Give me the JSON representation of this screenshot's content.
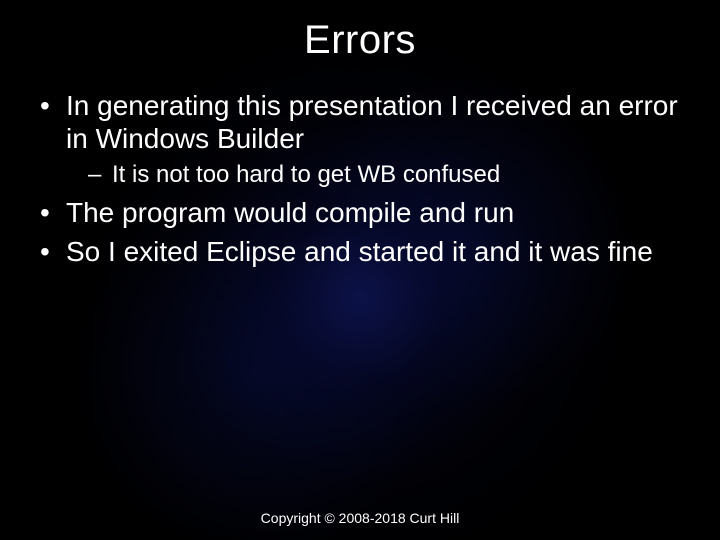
{
  "slide": {
    "title": "Errors",
    "bullets": {
      "b1": "In generating this presentation I received an error in Windows Builder",
      "b1_sub1": "It is not too hard to get WB confused",
      "b2": "The program would compile and run",
      "b3": "So I exited Eclipse and started it and it was fine"
    },
    "footer": "Copyright © 2008-2018 Curt Hill"
  }
}
